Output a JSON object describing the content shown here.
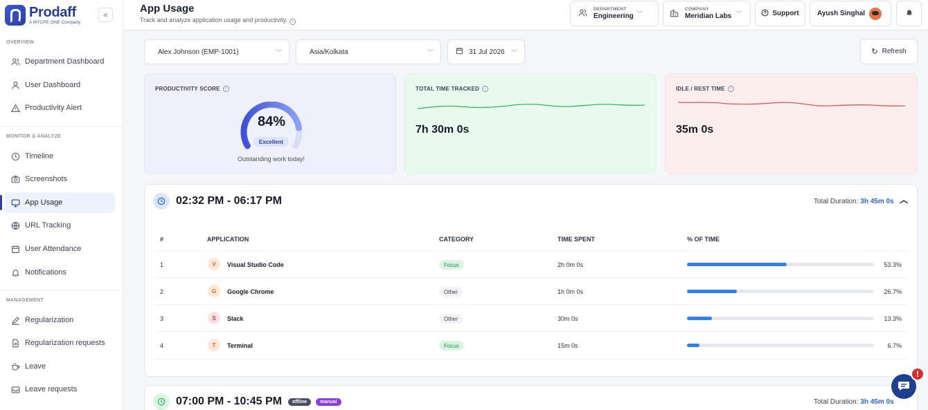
{
  "brand": {
    "name": "Prodaff",
    "tagline": "A MYCPE ONE Company",
    "collapse_icon": "«"
  },
  "sidebar": {
    "sections": [
      {
        "label": "OVERVIEW"
      },
      {
        "label": "MONITOR & ANALYZE"
      },
      {
        "label": "MANAGEMENT"
      }
    ],
    "items": [
      {
        "label": "Department Dashboard",
        "icon": "users-icon"
      },
      {
        "label": "User Dashboard",
        "icon": "user-icon"
      },
      {
        "label": "Productivity Alert",
        "icon": "alert-icon"
      },
      {
        "label": "Timeline",
        "icon": "clock-icon"
      },
      {
        "label": "Screenshots",
        "icon": "camera-icon"
      },
      {
        "label": "App Usage",
        "icon": "monitor-icon",
        "active": true
      },
      {
        "label": "URL Tracking",
        "icon": "globe-icon"
      },
      {
        "label": "User Attendance",
        "icon": "calendar-icon"
      },
      {
        "label": "Notifications",
        "icon": "bell-icon"
      },
      {
        "label": "Regularization",
        "icon": "pen-icon"
      },
      {
        "label": "Regularization requests",
        "icon": "document-icon"
      },
      {
        "label": "Leave",
        "icon": "cup-icon"
      },
      {
        "label": "Leave requests",
        "icon": "mail-icon"
      }
    ]
  },
  "header": {
    "title": "App Usage",
    "subtitle": "Track and analyze application usage and productivity.",
    "department": {
      "label": "DEPARTMENT",
      "value": "Engineering"
    },
    "company": {
      "label": "COMPANY",
      "value": "Meridian Labs"
    },
    "support": "Support",
    "user": "Ayush Singhal"
  },
  "filters": {
    "employee": "Alex Johnson (EMP-1001)",
    "timezone": "Asia/Kolkata",
    "date": "31 Jul 2026",
    "refresh": "Refresh"
  },
  "stats": {
    "productivity": {
      "label": "PRODUCTIVITY SCORE",
      "value": "84%",
      "score": 84,
      "rating": "Excellent",
      "note": "Outstanding work today!"
    },
    "total": {
      "label": "TOTAL TIME TRACKED",
      "value": "7h 30m 0s",
      "color": "#2fb866"
    },
    "idle": {
      "label": "IDLE / REST TIME",
      "value": "35m 0s",
      "color": "#e05555"
    }
  },
  "table_headers": {
    "num": "#",
    "app": "APPLICATION",
    "category": "CATEGORY",
    "time": "TIME SPENT",
    "pct": "% OF TIME"
  },
  "sessions": [
    {
      "range": "02:32 PM - 06:17 PM",
      "duration_label": "Total Duration:",
      "duration": "3h 45m 0s",
      "rows": [
        {
          "num": "1",
          "letter": "V",
          "app": "Visual Studio Code",
          "category": "Focus",
          "time": "2h 0m 0s",
          "pct_label": "53.3%",
          "pct": 53.3
        },
        {
          "num": "2",
          "letter": "G",
          "app": "Google Chrome",
          "category": "Other",
          "time": "1h 0m 0s",
          "pct_label": "26.7%",
          "pct": 26.7
        },
        {
          "num": "3",
          "letter": "S",
          "app": "Slack",
          "category": "Other",
          "time": "30m 0s",
          "pct_label": "13.3%",
          "pct": 13.3
        },
        {
          "num": "4",
          "letter": "T",
          "app": "Terminal",
          "category": "Focus",
          "time": "15m 0s",
          "pct_label": "6.7%",
          "pct": 6.7
        }
      ]
    },
    {
      "range": "07:00 PM - 10:45 PM",
      "duration_label": "Total Duration:",
      "duration": "3h 45m 0s",
      "tags": [
        "offline",
        "manual"
      ]
    }
  ],
  "chat": {
    "alert": "!"
  }
}
